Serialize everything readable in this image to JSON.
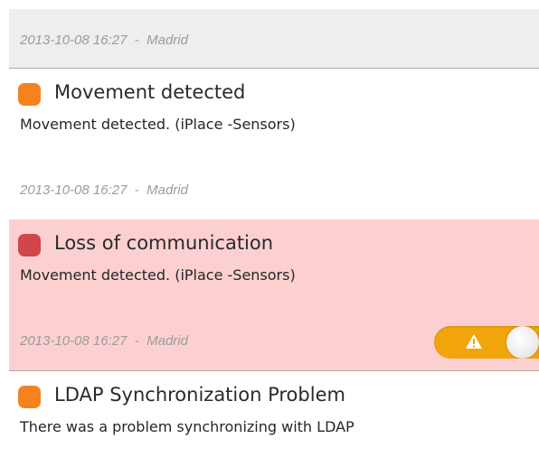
{
  "top_meta": {
    "timestamp": "2013-10-08 16:27",
    "separator": "-",
    "location": "Madrid"
  },
  "notifications": [
    {
      "severity_color": "#f5821f",
      "title": "Movement detected",
      "description": "Movement detected. (iPlace -Sensors)",
      "timestamp": "2013-10-08 16:27",
      "separator": "-",
      "location": "Madrid",
      "background": "#ffffff"
    },
    {
      "severity_color": "#d0464b",
      "title": "Loss of communication",
      "description": "Movement detected. (iPlace -Sensors)",
      "timestamp": "2013-10-08 16:27",
      "separator": "-",
      "location": "Madrid",
      "background": "#fcd0d1",
      "toggle": {
        "icon": "warning-icon",
        "color": "#f2a40b",
        "state": "on"
      }
    },
    {
      "severity_color": "#f5821f",
      "title": "LDAP Synchronization Problem",
      "description": "There was a problem synchronizing with LDAP",
      "background": "#ffffff"
    }
  ]
}
